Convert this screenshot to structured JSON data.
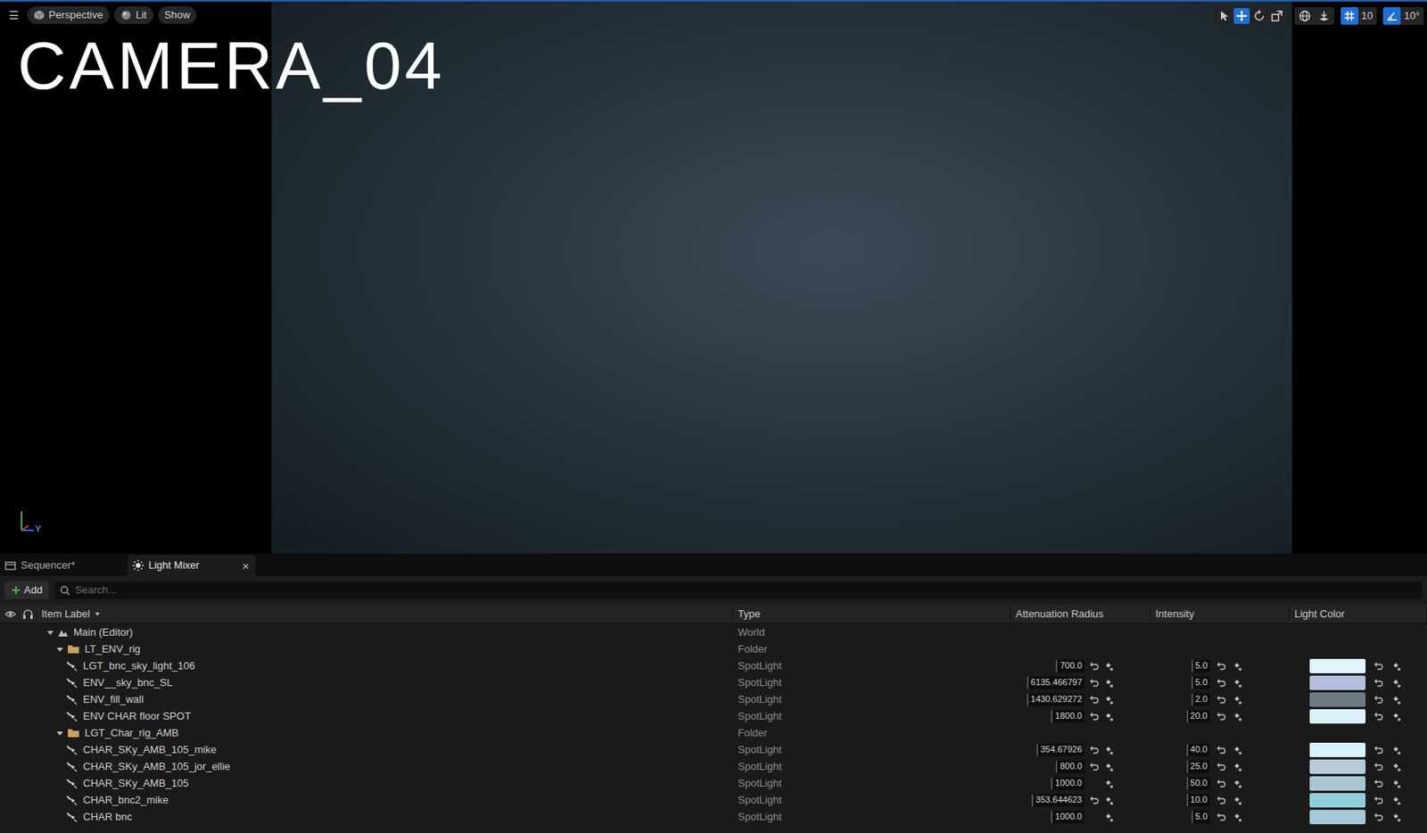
{
  "viewport": {
    "toolbar": {
      "menu": "☰",
      "view_mode": "Perspective",
      "lighting": "Lit",
      "show": "Show"
    },
    "tools": [
      {
        "name": "select",
        "selected": false
      },
      {
        "name": "move",
        "selected": true
      },
      {
        "name": "rotate",
        "selected": false
      },
      {
        "name": "scale",
        "selected": false
      }
    ],
    "grid_snap": {
      "value": "10",
      "on": true
    },
    "rotation_snap": {
      "value": "10°",
      "on": true
    },
    "overlay_title": "CAMERA_04",
    "axis_label": "Y"
  },
  "panel_tabs": [
    {
      "label": "Sequencer*",
      "selected": false,
      "closable": false
    },
    {
      "label": "Light Mixer",
      "selected": true,
      "closable": true
    }
  ],
  "close_glyph": "×",
  "add_button": "Add",
  "search": {
    "placeholder": "Search..."
  },
  "table": {
    "columns": [
      "Item Label",
      "Type",
      "Attenuation Radius",
      "Intensity",
      "Light Color"
    ],
    "rows": [
      {
        "label": "Main (Editor)",
        "type": "World",
        "kind": "world",
        "depth": 0,
        "expanded": true
      },
      {
        "label": "LT_ENV_rig",
        "type": "Folder",
        "kind": "folder",
        "depth": 1,
        "expanded": true
      },
      {
        "label": "LGT_bnc_sky_light_106",
        "type": "SpotLight",
        "kind": "light",
        "depth": 2,
        "attenuation": "700.0",
        "attenuation_modified": true,
        "intensity": "5.0",
        "color": "#e2f4fb"
      },
      {
        "label": "ENV__sky_bnc_SL",
        "type": "SpotLight",
        "kind": "light",
        "depth": 2,
        "attenuation": "6135.466797",
        "attenuation_modified": true,
        "intensity": "5.0",
        "color": "#b4bfdc"
      },
      {
        "label": "ENV_fill_wall",
        "type": "SpotLight",
        "kind": "light",
        "depth": 2,
        "attenuation": "1430.629272",
        "attenuation_modified": true,
        "intensity": "2.0",
        "color": "#6c7a82"
      },
      {
        "label": "ENV CHAR floor SPOT",
        "type": "SpotLight",
        "kind": "light",
        "depth": 2,
        "attenuation": "1800.0",
        "attenuation_modified": true,
        "intensity": "20.0",
        "color": "#dbf2fb"
      },
      {
        "label": "LGT_Char_rig_AMB",
        "type": "Folder",
        "kind": "folder",
        "depth": 1,
        "expanded": true
      },
      {
        "label": "CHAR_SKy_AMB_105_mike",
        "type": "SpotLight",
        "kind": "light",
        "depth": 2,
        "attenuation": "354.67926",
        "attenuation_modified": true,
        "intensity": "40.0",
        "color": "#d8f1fb"
      },
      {
        "label": "CHAR_SKy_AMB_105_jor_ellie",
        "type": "SpotLight",
        "kind": "light",
        "depth": 2,
        "attenuation": "800.0",
        "attenuation_modified": true,
        "intensity": "25.0",
        "color": "#b5cbd8"
      },
      {
        "label": "CHAR_SKy_AMB_105",
        "type": "SpotLight",
        "kind": "light",
        "depth": 2,
        "attenuation": "1000.0",
        "attenuation_modified": false,
        "intensity": "50.0",
        "color": "#a9c5d0"
      },
      {
        "label": "CHAR_bnc2_mike",
        "type": "SpotLight",
        "kind": "light",
        "depth": 2,
        "attenuation": "353.644623",
        "attenuation_modified": true,
        "intensity": "10.0",
        "color": "#8ecfdb"
      },
      {
        "label": "CHAR bnc",
        "type": "SpotLight",
        "kind": "light",
        "depth": 2,
        "attenuation": "1000.0",
        "attenuation_modified": false,
        "intensity": "5.0",
        "color": "#a6c8d6"
      }
    ]
  }
}
